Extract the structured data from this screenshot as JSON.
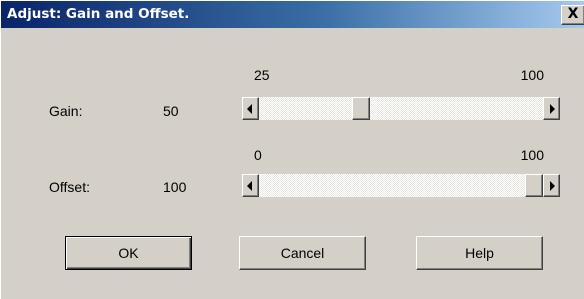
{
  "window": {
    "title": "Adjust: Gain and Offset.",
    "close_glyph": "X"
  },
  "gain": {
    "label": "Gain:",
    "value": "50",
    "range_min": "25",
    "range_max": "100",
    "thumb_fraction": 0.35
  },
  "offset": {
    "label": "Offset:",
    "value": "100",
    "range_min": "0",
    "range_max": "100",
    "thumb_fraction": 1.0
  },
  "buttons": {
    "ok": "OK",
    "cancel": "Cancel",
    "help": "Help"
  },
  "icons": {
    "close": "close-icon",
    "scroll_left": "arrow-left-icon",
    "scroll_right": "arrow-right-icon"
  },
  "colors": {
    "dialog_face": "#d4d0c8",
    "title_active_start": "#0a246a",
    "title_active_end": "#a6caf0",
    "title_text": "#ffffff"
  }
}
